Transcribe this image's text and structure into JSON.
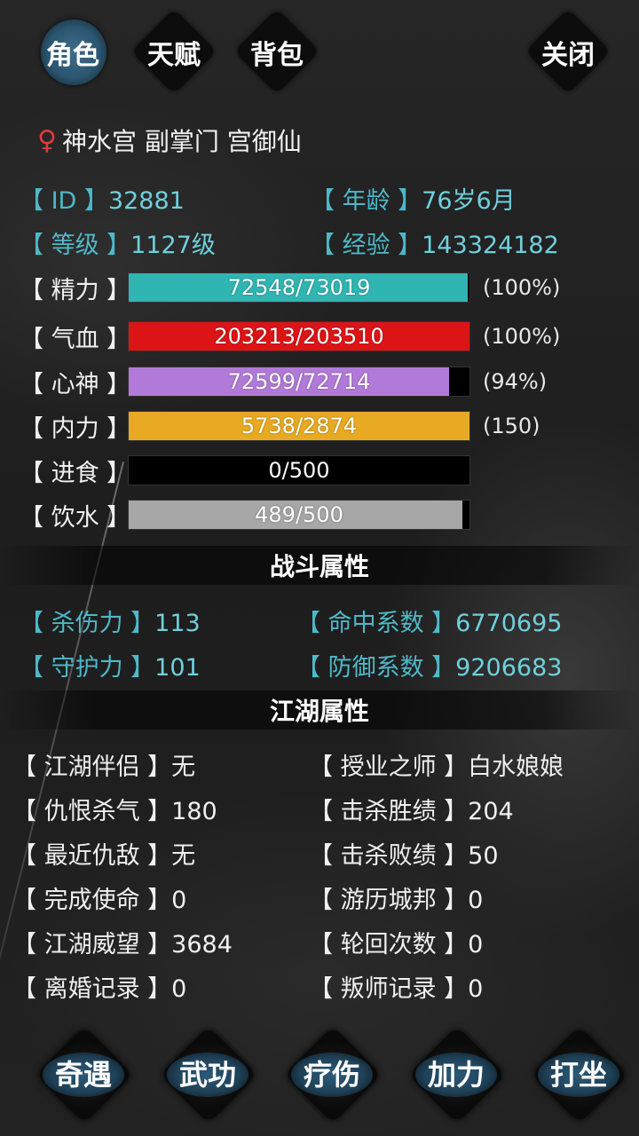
{
  "tabs": [
    {
      "label": "角色",
      "active": true
    },
    {
      "label": "天赋",
      "active": false
    },
    {
      "label": "背包",
      "active": false
    }
  ],
  "close_label": "关闭",
  "identity": {
    "gender_icon": "female-symbol-icon",
    "gender_glyph": "♀",
    "text": "神水宫 副掌门 宫御仙"
  },
  "basic": {
    "id_label": "【  ID  】",
    "id_value": "32881",
    "age_label": "【 年龄 】",
    "age_value": "76岁6月",
    "level_label": "【 等级 】",
    "level_value": "1127级",
    "exp_label": "【 经验 】",
    "exp_value": "143324182"
  },
  "bars": [
    {
      "label": "【 精力 】",
      "text": "72548/73019",
      "fill": 0.994,
      "color": "#2fb6b3",
      "pct": "(100%)"
    },
    {
      "label": "【 气血 】",
      "text": "203213/203510",
      "fill": 0.999,
      "color": "#dd1416",
      "pct": "(100%)"
    },
    {
      "label": "【 心神 】",
      "text": "72599/72714",
      "fill": 0.94,
      "color": "#b27ad8",
      "pct": "(94%)"
    },
    {
      "label": "【 内力 】",
      "text": "5738/2874",
      "fill": 1.0,
      "color": "#e7aa22",
      "pct": "(150)"
    },
    {
      "label": "【 进食 】",
      "text": "0/500",
      "fill": 0.0,
      "color": "#888888",
      "pct": ""
    },
    {
      "label": "【 饮水 】",
      "text": "489/500",
      "fill": 0.978,
      "color": "#a7a7a7",
      "pct": ""
    }
  ],
  "combat_title": "战斗属性",
  "combat": {
    "kill_label": "【 杀伤力 】",
    "kill_value": "113",
    "hit_label": "【 命中系数 】",
    "hit_value": "6770695",
    "guard_label": "【 守护力 】",
    "guard_value": "101",
    "def_label": "【 防御系数 】",
    "def_value": "9206683"
  },
  "jianghu_title": "江湖属性",
  "jianghu": [
    {
      "label": "【 江湖伴侣 】",
      "value": "无"
    },
    {
      "label": "【 授业之师 】",
      "value": "白水娘娘"
    },
    {
      "label": "【 仇恨杀气 】",
      "value": "180"
    },
    {
      "label": "【 击杀胜绩 】",
      "value": "204"
    },
    {
      "label": "【 最近仇敌 】",
      "value": "无"
    },
    {
      "label": "【 击杀败绩 】",
      "value": "50"
    },
    {
      "label": "【 完成使命 】",
      "value": "0"
    },
    {
      "label": "【 游历城邦 】",
      "value": "0"
    },
    {
      "label": "【 江湖威望 】",
      "value": "3684"
    },
    {
      "label": "【 轮回次数 】",
      "value": "0"
    },
    {
      "label": "【 离婚记录 】",
      "value": "0"
    },
    {
      "label": "【 叛师记录 】",
      "value": "0"
    }
  ],
  "actions": [
    "奇遇",
    "武功",
    "疗伤",
    "加力",
    "打坐"
  ]
}
